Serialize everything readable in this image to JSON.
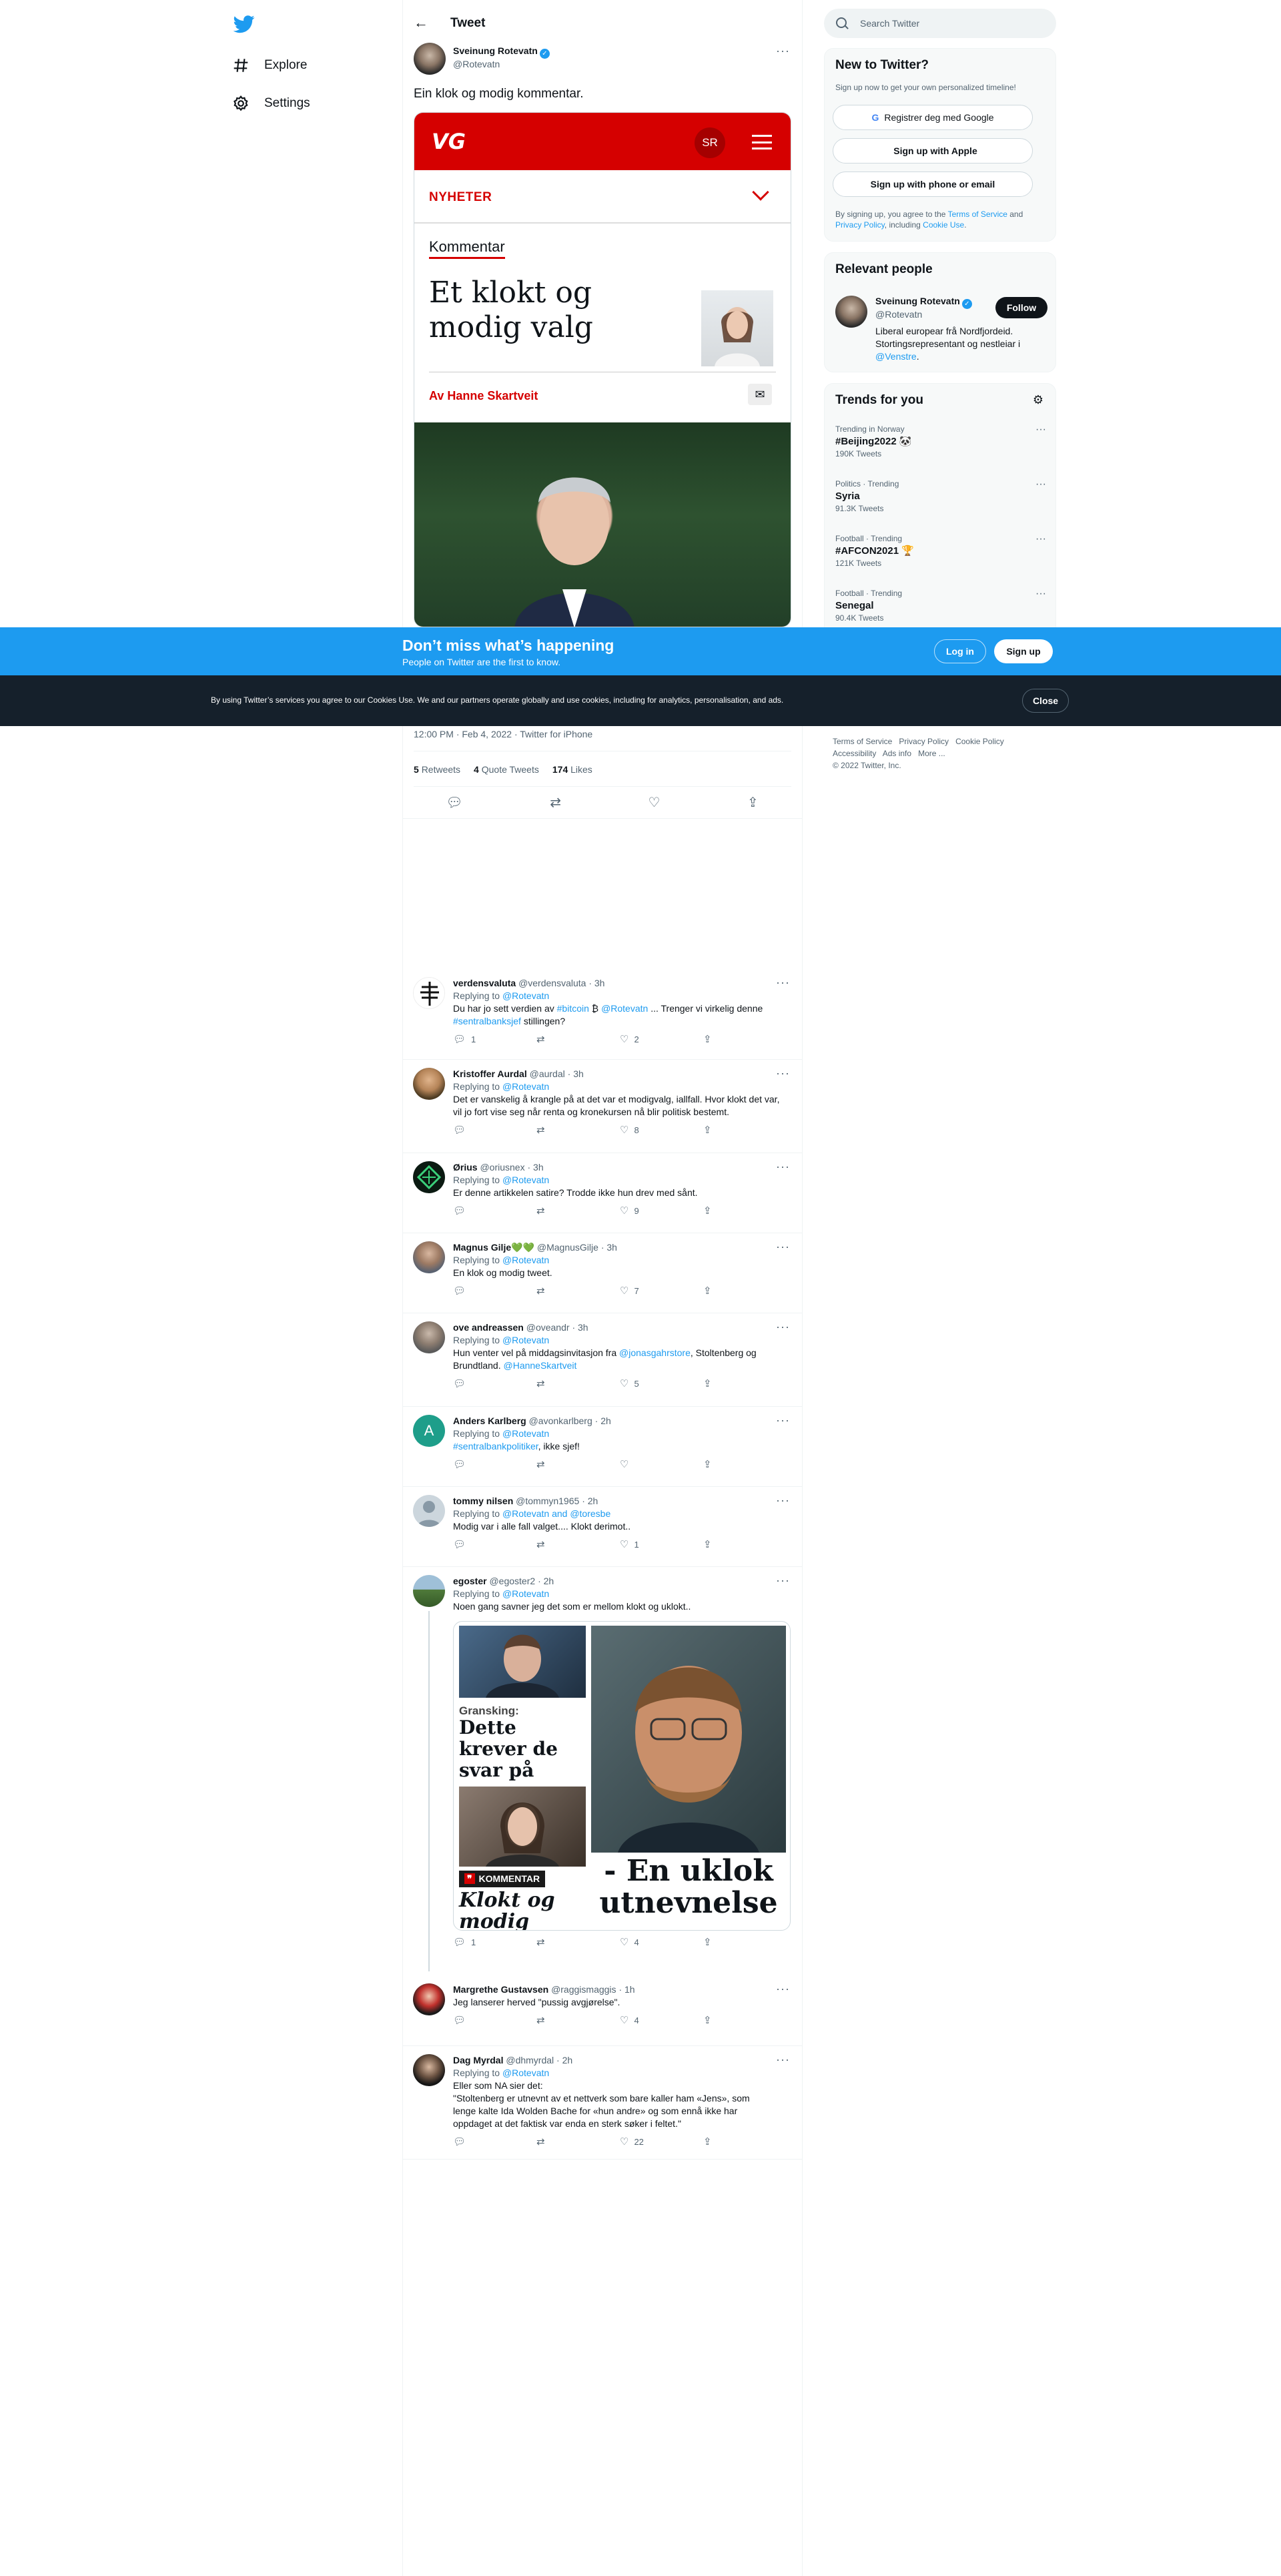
{
  "nav": {
    "explore": "Explore",
    "settings": "Settings"
  },
  "header": {
    "title": "Tweet"
  },
  "tweet": {
    "author_name": "Sveinung Rotevatn",
    "author_handle": "@Rotevatn",
    "text": "Ein klok og modig kommentar.",
    "timestamp": "12:00 PM · Feb 4, 2022 · Twitter for iPhone",
    "retweets_count": "5",
    "retweets_label": "Retweets",
    "quotes_count": "4",
    "quotes_label": "Quote Tweets",
    "likes_count": "174",
    "likes_label": "Likes"
  },
  "article_card": {
    "brand": "VG",
    "user_initials": "SR",
    "section": "NYHETER",
    "category": "Kommentar",
    "headline": "Et klokt og modig valg",
    "byline": "Av Hanne Skartveit"
  },
  "replies": [
    {
      "name": "verdensvaluta",
      "handle": "@verdensvaluta",
      "time": "· 3h",
      "replying_prefix": "Replying to ",
      "replying_to": "@Rotevatn",
      "text_parts": [
        "Du har jo sett verdien av ",
        "#bitcoin",
        " ₿ ",
        "@Rotevatn",
        " ... Trenger vi virkelig denne ",
        "#sentralbanksjef",
        " stillingen?"
      ],
      "replies": "1",
      "retweets": "",
      "likes": "2"
    },
    {
      "name": "Kristoffer Aurdal",
      "handle": "@aurdal",
      "time": "· 3h",
      "replying_prefix": "Replying to ",
      "replying_to": "@Rotevatn",
      "text": "Det er vanskelig å krangle på at det var et modigvalg, iallfall. Hvor klokt det var, vil jo fort vise seg når renta og kronekursen nå blir politisk bestemt.",
      "replies": "",
      "retweets": "",
      "likes": "8"
    },
    {
      "name": "Ørius",
      "handle": "@oriusnex",
      "time": "· 3h",
      "replying_prefix": "Replying to ",
      "replying_to": "@Rotevatn",
      "text": "Er denne artikkelen satire? Trodde ikke hun drev med sånt.",
      "replies": "",
      "retweets": "",
      "likes": "9"
    },
    {
      "name": "Magnus Gilje💚💚",
      "handle": "@MagnusGilje",
      "time": "· 3h",
      "replying_prefix": "Replying to ",
      "replying_to": "@Rotevatn",
      "text": "En klok og modig tweet.",
      "replies": "",
      "retweets": "",
      "likes": "7"
    },
    {
      "name": "ove andreassen",
      "handle": "@oveandr",
      "time": "· 3h",
      "replying_prefix": "Replying to ",
      "replying_to": "@Rotevatn",
      "text_parts": [
        "Hun venter vel på middagsinvitasjon fra ",
        "@jonasgahrstore",
        ", Stoltenberg og Brundtland. ",
        "@HanneSkartveit"
      ],
      "replies": "",
      "retweets": "",
      "likes": "5"
    },
    {
      "name": "Anders Karlberg",
      "handle": "@avonkarlberg",
      "time": "· 2h",
      "replying_prefix": "Replying to ",
      "replying_to": "@Rotevatn",
      "text_parts": [
        "#sentralbankpolitiker",
        ", ikke sjef!"
      ],
      "replies": "",
      "retweets": "",
      "likes": "",
      "avatar_letter": "A"
    },
    {
      "name": "tommy nilsen",
      "handle": "@tommyn1965",
      "time": "· 2h",
      "replying_prefix": "Replying to ",
      "replying_to": "@Rotevatn and @toresbe",
      "text": "Modig var i alle fall valget.... Klokt derimot..",
      "replies": "",
      "retweets": "",
      "likes": "1"
    },
    {
      "name": "egoster",
      "handle": "@egoster2",
      "time": "· 2h",
      "replying_prefix": "Replying to ",
      "replying_to": "@Rotevatn",
      "text": "Noen gang savner jeg det som er mellom klokt og uklokt..",
      "img_left_text1": "Gransking:",
      "img_left_text2": "Dette krever de svar på",
      "img_left_badge": "KOMMENTAR",
      "img_left_text3": "Klokt og modig",
      "img_right_text": "- En uklok utnevnelse",
      "replies": "1",
      "retweets": "",
      "likes": "4"
    },
    {
      "name": "Margrethe Gustavsen",
      "handle": "@raggismaggis",
      "time": "· 1h",
      "text": "Jeg lanserer herved \"pussig avgjørelse\".",
      "replies": "",
      "retweets": "",
      "likes": "4"
    },
    {
      "name": "Dag Myrdal",
      "handle": "@dhmyrdal",
      "time": "· 2h",
      "replying_prefix": "Replying to ",
      "replying_to": "@Rotevatn",
      "text": "Eller som NA sier det:\n\"Stoltenberg er utnevnt av et nettverk som bare kaller ham «Jens», som lenge kalte Ida Wolden Bache for «hun andre» og som ennå ikke har oppdaget at det faktisk var enda en sterk søker i feltet.\"",
      "replies": "",
      "retweets": "",
      "likes": "22"
    }
  ],
  "search": {
    "placeholder": "Search Twitter"
  },
  "signup": {
    "title": "New to Twitter?",
    "subtitle": "Sign up now to get your own personalized timeline!",
    "google": "Registrer deg med Google",
    "apple": "Sign up with Apple",
    "phone": "Sign up with phone or email",
    "legal_1": "By signing up, you agree to the ",
    "terms": "Terms of Service",
    "legal_2": " and ",
    "privacy": "Privacy Policy",
    "legal_3": ", including ",
    "cookie": "Cookie Use",
    "legal_4": "."
  },
  "relevant": {
    "title": "Relevant people",
    "name": "Sveinung Rotevatn",
    "handle": "@Rotevatn",
    "follow": "Follow",
    "bio": "Liberal europear frå Nordfjordeid. Stortingsrepresentant og nestleiar i ",
    "bio_link": "@Venstre",
    "bio_end": "."
  },
  "trends": {
    "title": "Trends for you",
    "items": [
      {
        "context": "Trending in Norway",
        "name": "#Beijing2022",
        "emoji": "🐼",
        "count": "190K Tweets"
      },
      {
        "context": "Politics · Trending",
        "name": "Syria",
        "emoji": "",
        "count": "91.3K Tweets"
      },
      {
        "context": "Football · Trending",
        "name": "#AFCON2021",
        "emoji": "🏆",
        "count": "121K Tweets"
      },
      {
        "context": "Football · Trending",
        "name": "Senegal",
        "emoji": "",
        "count": "90.4K Tweets"
      }
    ]
  },
  "footer": {
    "row1": [
      "Terms of Service",
      "Privacy Policy",
      "Cookie Policy"
    ],
    "row2": [
      "Accessibility",
      "Ads info",
      "More ..."
    ],
    "copyright": "© 2022 Twitter, Inc."
  },
  "banner": {
    "title": "Don’t miss what’s happening",
    "subtitle": "People on Twitter are the first to know.",
    "login": "Log in",
    "signup": "Sign up"
  },
  "cookie_bar": {
    "text": "By using Twitter’s services you agree to our Cookies Use. We and our partners operate globally and use cookies, including for analytics, personalisation, and ads.",
    "close": "Close"
  },
  "colors": {
    "brand": "#1d9bf0",
    "vg_red": "#d50000",
    "cookie_bg": "#15202b"
  }
}
